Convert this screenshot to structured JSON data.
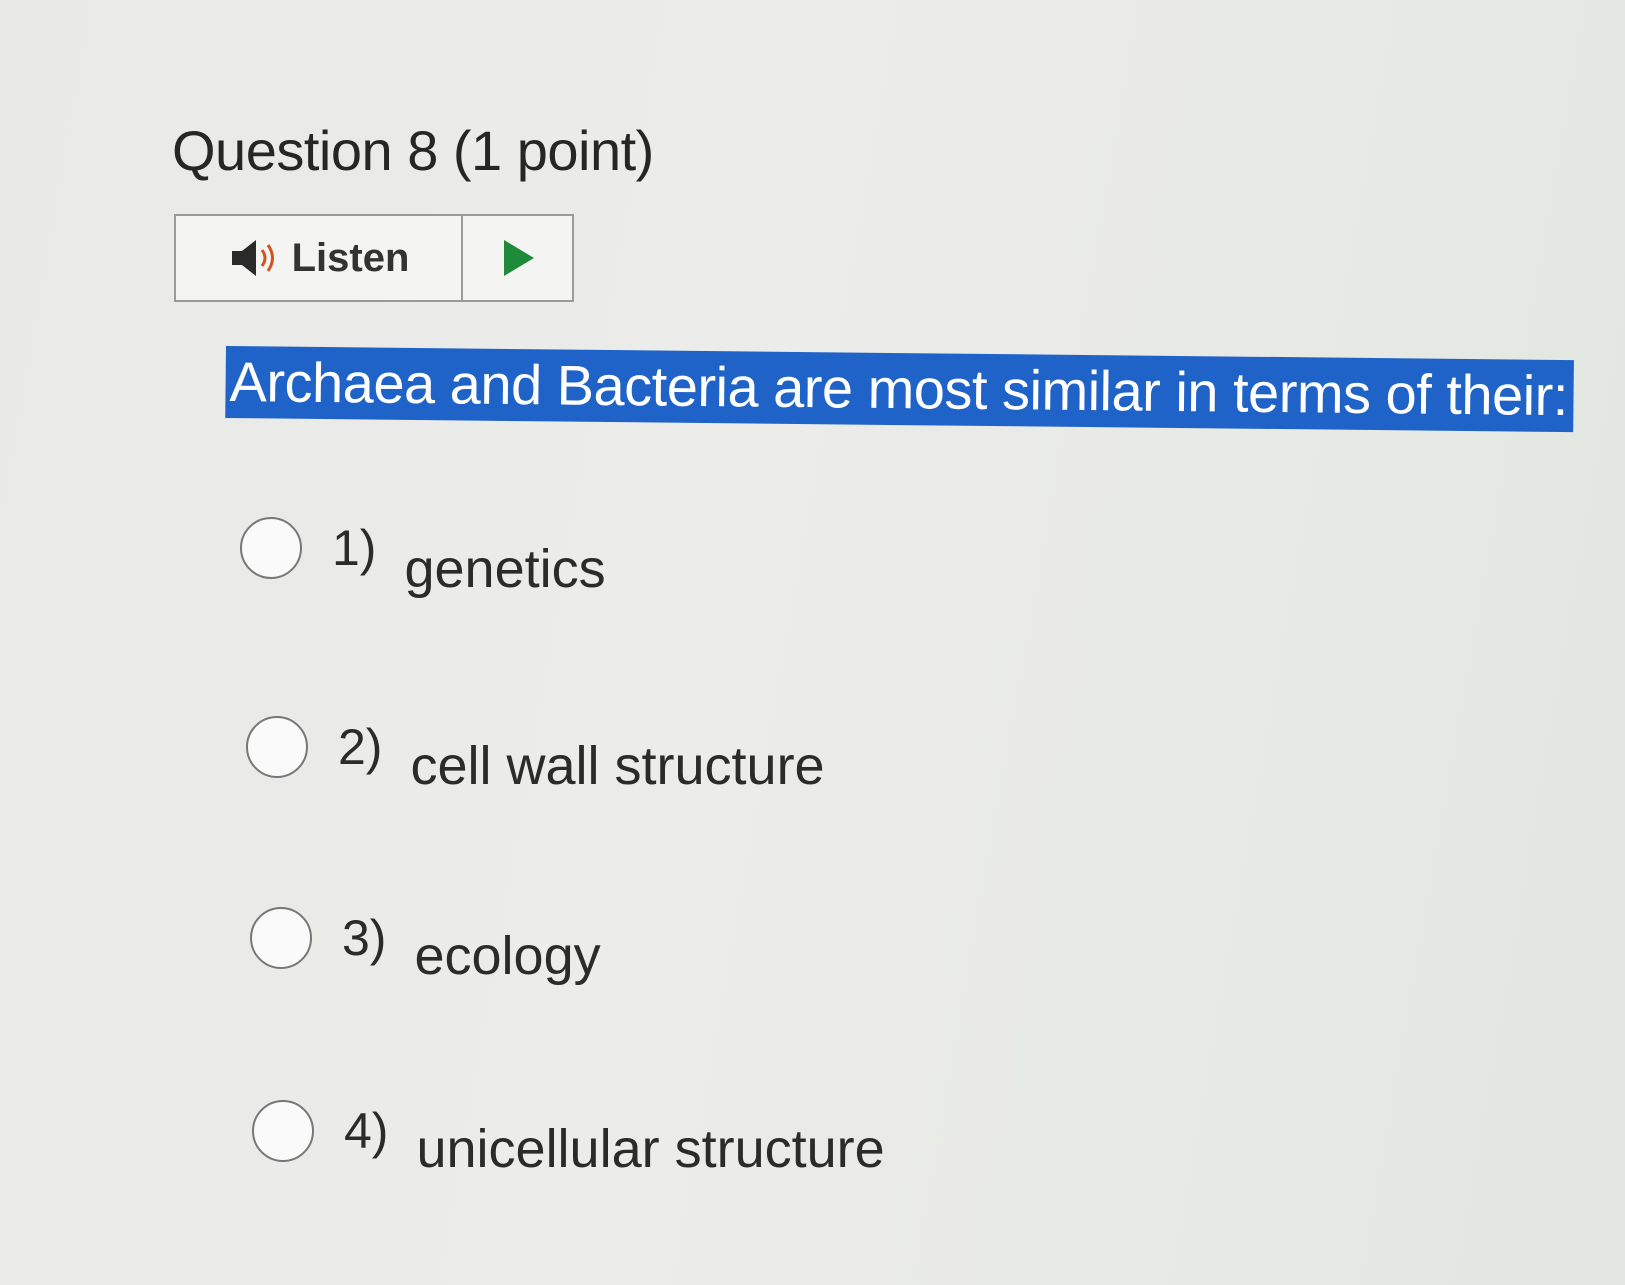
{
  "question": {
    "title": "Question 8 (1 point)"
  },
  "listen": {
    "label": "Listen"
  },
  "prompt": "Archaea and Bacteria are most similar in terms of their:",
  "options": [
    {
      "number": "1)",
      "text": "genetics"
    },
    {
      "number": "2)",
      "text": "cell wall structure"
    },
    {
      "number": "3)",
      "text": "ecology"
    },
    {
      "number": "4)",
      "text": "unicellular structure"
    }
  ],
  "colors": {
    "highlight": "#1f63c9",
    "play_icon": "#1e8b3a",
    "speaker_wave": "#d2531e"
  }
}
